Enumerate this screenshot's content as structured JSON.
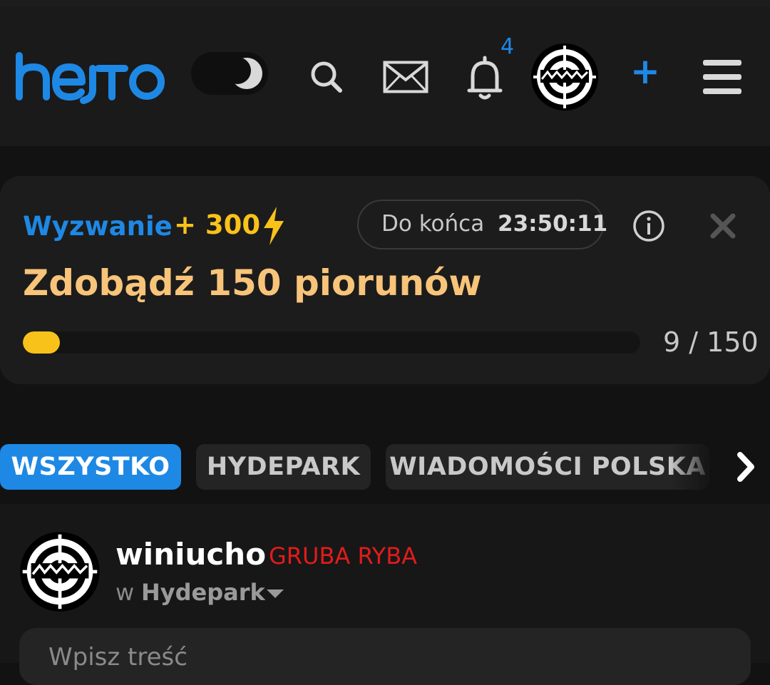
{
  "header": {
    "logo_text": "hejto",
    "theme_toggle": "dark-mode-toggle",
    "icons": [
      "search-icon",
      "mail-icon",
      "bell-icon",
      "avatar",
      "plus-icon",
      "menu-icon"
    ],
    "notifications_count": "4",
    "add_label": "+",
    "accent_color": "#1e88e5"
  },
  "challenge": {
    "label": "Wyzwanie",
    "points": "+ 300",
    "timer_label": "Do końca",
    "timer_value": "23:50:11",
    "title": "Zdobądź 150 piorunów",
    "progress_text": "9 / 150",
    "progress_current": 9,
    "progress_total": 150,
    "progress_color": "#f9c21a",
    "title_color": "#f7c47a"
  },
  "tabs": [
    {
      "label": "WSZYSTKO",
      "active": true
    },
    {
      "label": "HYDEPARK",
      "active": false
    },
    {
      "label": "WIADOMOŚCI POLSKA",
      "active": false
    }
  ],
  "post": {
    "username": "winiucho",
    "rank": "GRUBA RYBA",
    "rank_color": "#e21b1b",
    "in_prefix": "w",
    "community": "Hydepark",
    "editor_placeholder": "Wpisz treść"
  }
}
